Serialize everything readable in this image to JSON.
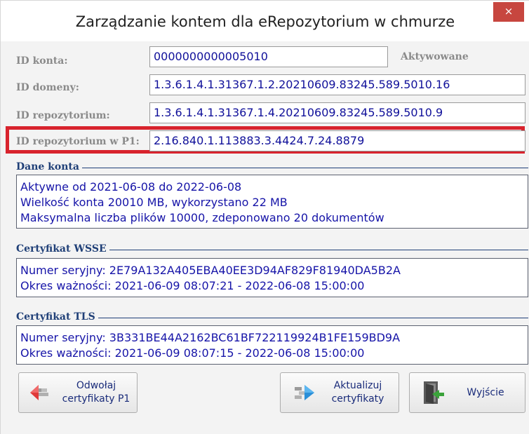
{
  "window": {
    "title": "Zarządzanie kontem dla eRepozytorium w chmurze",
    "close_glyph": "×"
  },
  "fields": [
    {
      "label": "ID konta:",
      "value": "0000000000005010"
    },
    {
      "label": "ID domeny:",
      "value": "1.3.6.1.4.1.31367.1.2.20210609.83245.589.5010.16"
    },
    {
      "label": "ID repozytorium:",
      "value": "1.3.6.1.4.1.31367.1.4.20210609.83245.589.5010.9"
    },
    {
      "label": "ID repozytorium w P1:",
      "value": "2.16.840.1.113883.3.4424.7.24.8879"
    }
  ],
  "status": "Aktywowane",
  "groups": {
    "account": {
      "title": "Dane konta",
      "lines": [
        "Aktywne od 2021-06-08 do 2022-06-08",
        "Wielkość konta 20010 MB, wykorzystano 22 MB",
        "Maksymalna liczba plików 10000, zdeponowano 20 dokumentów"
      ]
    },
    "wsse": {
      "title": "Certyfikat WSSE",
      "lines": [
        "Numer seryjny: 2E79A132A405EBA40EE3D94AF829F81940DA5B2A",
        "Okres ważności: 2021-06-09 08:07:21 - 2022-06-08 15:00:00"
      ]
    },
    "tls": {
      "title": "Certyfikat TLS",
      "lines": [
        "Numer seryjny: 3B331BE44A2162BC61BF722119924B1FE159BD9A",
        "Okres ważności: 2021-06-09 08:07:15 - 2022-06-08 15:00:00"
      ]
    }
  },
  "buttons": {
    "revoke": {
      "line1": "Odwołaj",
      "line2": "certyfikaty P1",
      "icon": "revoke-arrow-icon"
    },
    "update": {
      "line1": "Aktualizuj",
      "line2": "certyfikaty",
      "icon": "update-arrow-icon"
    },
    "exit": {
      "label": "Wyjście",
      "icon": "exit-door-icon"
    }
  },
  "colors": {
    "highlight_border": "#d8232d",
    "close_button": "#c7463f",
    "field_text": "#10109a",
    "group_title": "#1f3f77"
  }
}
